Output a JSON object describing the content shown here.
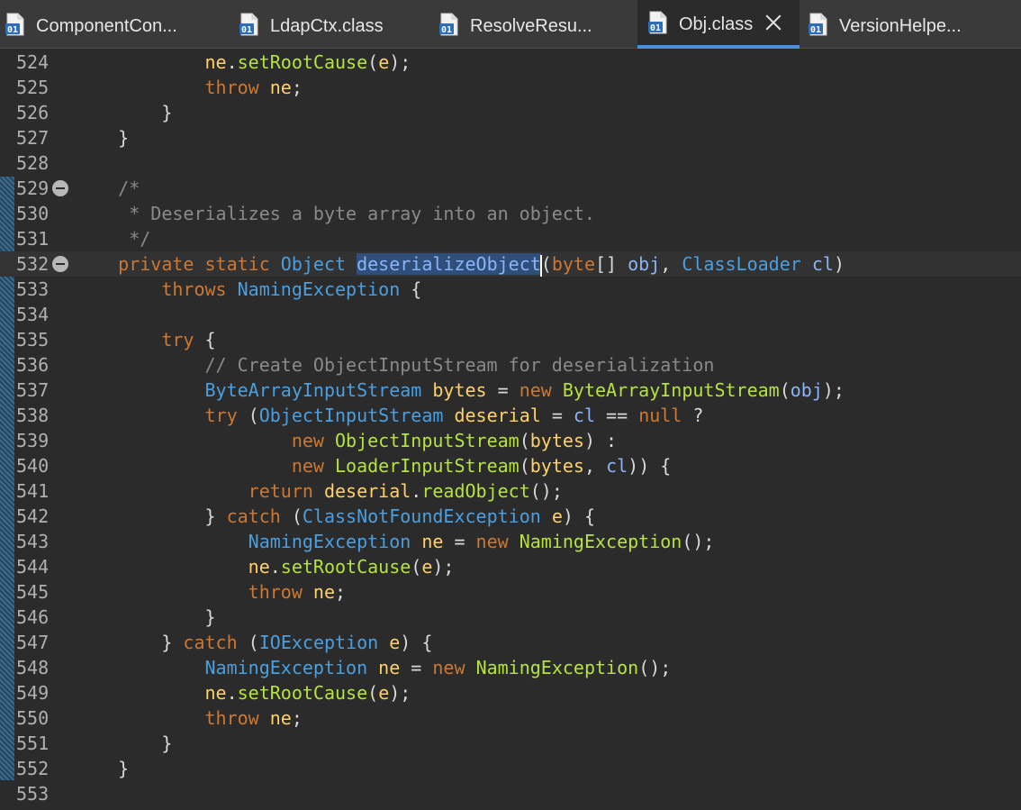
{
  "tabs": [
    {
      "label": "ComponentCon...",
      "icon": "class-file-icon",
      "active": false
    },
    {
      "label": "LdapCtx.class",
      "icon": "class-file-icon",
      "active": false
    },
    {
      "label": "ResolveResu...",
      "icon": "class-file-icon",
      "active": false
    },
    {
      "label": "Obj.class",
      "icon": "class-file-icon",
      "active": true
    },
    {
      "label": "VersionHelpe...",
      "icon": "class-file-icon",
      "active": false
    }
  ],
  "editor": {
    "current_line": 532,
    "selected_text": "deserializeObject",
    "lines": [
      {
        "n": "524",
        "tokens": [
          [
            "pl",
            "            "
          ],
          [
            "vr",
            "ne"
          ],
          [
            "pl",
            "."
          ],
          [
            "fn",
            "setRootCause"
          ],
          [
            "pl",
            "("
          ],
          [
            "vr",
            "e"
          ],
          [
            "pl",
            ");"
          ]
        ]
      },
      {
        "n": "525",
        "tokens": [
          [
            "pl",
            "            "
          ],
          [
            "kw",
            "throw"
          ],
          [
            "pl",
            " "
          ],
          [
            "vr",
            "ne"
          ],
          [
            "pl",
            ";"
          ]
        ]
      },
      {
        "n": "526",
        "tokens": [
          [
            "pl",
            "        }"
          ]
        ]
      },
      {
        "n": "527",
        "tokens": [
          [
            "pl",
            "    }"
          ]
        ]
      },
      {
        "n": "528",
        "tokens": []
      },
      {
        "n": "529",
        "fold": true,
        "tokens": [
          [
            "cm",
            "    /*"
          ]
        ]
      },
      {
        "n": "530",
        "tokens": [
          [
            "cm",
            "     * Deserializes a byte array into an object."
          ]
        ]
      },
      {
        "n": "531",
        "tokens": [
          [
            "cm",
            "     */"
          ]
        ]
      },
      {
        "n": "532",
        "fold": true,
        "tokens": [
          [
            "kw",
            "    private static "
          ],
          [
            "ty",
            "Object"
          ],
          [
            "pl",
            " "
          ],
          [
            "sel",
            "deserializeObject"
          ],
          [
            "caret",
            ""
          ],
          [
            "pl",
            "("
          ],
          [
            "kw",
            "byte"
          ],
          [
            "pl",
            "[] "
          ],
          [
            "pr",
            "obj"
          ],
          [
            "pl",
            ", "
          ],
          [
            "ty",
            "ClassLoader"
          ],
          [
            "pl",
            " "
          ],
          [
            "pr",
            "cl"
          ],
          [
            "pl",
            ")"
          ]
        ]
      },
      {
        "n": "533",
        "tokens": [
          [
            "pl",
            "        "
          ],
          [
            "kw",
            "throws"
          ],
          [
            "pl",
            " "
          ],
          [
            "ty",
            "NamingException"
          ],
          [
            "pl",
            " {"
          ]
        ]
      },
      {
        "n": "534",
        "tokens": []
      },
      {
        "n": "535",
        "tokens": [
          [
            "pl",
            "        "
          ],
          [
            "kw",
            "try"
          ],
          [
            "pl",
            " {"
          ]
        ]
      },
      {
        "n": "536",
        "tokens": [
          [
            "cm",
            "            // Create ObjectInputStream for deserialization"
          ]
        ]
      },
      {
        "n": "537",
        "tokens": [
          [
            "pl",
            "            "
          ],
          [
            "ty",
            "ByteArrayInputStream"
          ],
          [
            "pl",
            " "
          ],
          [
            "vr",
            "bytes"
          ],
          [
            "pl",
            " = "
          ],
          [
            "kw",
            "new"
          ],
          [
            "pl",
            " "
          ],
          [
            "fn",
            "ByteArrayInputStream"
          ],
          [
            "pl",
            "("
          ],
          [
            "pr",
            "obj"
          ],
          [
            "pl",
            ");"
          ]
        ]
      },
      {
        "n": "538",
        "tokens": [
          [
            "pl",
            "            "
          ],
          [
            "kw",
            "try"
          ],
          [
            "pl",
            " ("
          ],
          [
            "ty",
            "ObjectInputStream"
          ],
          [
            "pl",
            " "
          ],
          [
            "vr",
            "deserial"
          ],
          [
            "pl",
            " = "
          ],
          [
            "pr",
            "cl"
          ],
          [
            "pl",
            " == "
          ],
          [
            "kw",
            "null"
          ],
          [
            "pl",
            " ?"
          ]
        ]
      },
      {
        "n": "539",
        "tokens": [
          [
            "pl",
            "                    "
          ],
          [
            "kw",
            "new"
          ],
          [
            "pl",
            " "
          ],
          [
            "fn",
            "ObjectInputStream"
          ],
          [
            "pl",
            "("
          ],
          [
            "vr",
            "bytes"
          ],
          [
            "pl",
            ") :"
          ]
        ]
      },
      {
        "n": "540",
        "tokens": [
          [
            "pl",
            "                    "
          ],
          [
            "kw",
            "new"
          ],
          [
            "pl",
            " "
          ],
          [
            "fn",
            "LoaderInputStream"
          ],
          [
            "pl",
            "("
          ],
          [
            "vr",
            "bytes"
          ],
          [
            "pl",
            ", "
          ],
          [
            "pr",
            "cl"
          ],
          [
            "pl",
            ")) {"
          ]
        ]
      },
      {
        "n": "541",
        "tokens": [
          [
            "pl",
            "                "
          ],
          [
            "kw",
            "return"
          ],
          [
            "pl",
            " "
          ],
          [
            "vr",
            "deserial"
          ],
          [
            "pl",
            "."
          ],
          [
            "fn",
            "readObject"
          ],
          [
            "pl",
            "();"
          ]
        ]
      },
      {
        "n": "542",
        "tokens": [
          [
            "pl",
            "            } "
          ],
          [
            "kw",
            "catch"
          ],
          [
            "pl",
            " ("
          ],
          [
            "ty",
            "ClassNotFoundException"
          ],
          [
            "pl",
            " "
          ],
          [
            "vr",
            "e"
          ],
          [
            "pl",
            ") {"
          ]
        ]
      },
      {
        "n": "543",
        "tokens": [
          [
            "pl",
            "                "
          ],
          [
            "ty",
            "NamingException"
          ],
          [
            "pl",
            " "
          ],
          [
            "vr",
            "ne"
          ],
          [
            "pl",
            " = "
          ],
          [
            "kw",
            "new"
          ],
          [
            "pl",
            " "
          ],
          [
            "fn",
            "NamingException"
          ],
          [
            "pl",
            "();"
          ]
        ]
      },
      {
        "n": "544",
        "tokens": [
          [
            "pl",
            "                "
          ],
          [
            "vr",
            "ne"
          ],
          [
            "pl",
            "."
          ],
          [
            "fn",
            "setRootCause"
          ],
          [
            "pl",
            "("
          ],
          [
            "vr",
            "e"
          ],
          [
            "pl",
            ");"
          ]
        ]
      },
      {
        "n": "545",
        "tokens": [
          [
            "pl",
            "                "
          ],
          [
            "kw",
            "throw"
          ],
          [
            "pl",
            " "
          ],
          [
            "vr",
            "ne"
          ],
          [
            "pl",
            ";"
          ]
        ]
      },
      {
        "n": "546",
        "tokens": [
          [
            "pl",
            "            }"
          ]
        ]
      },
      {
        "n": "547",
        "tokens": [
          [
            "pl",
            "        } "
          ],
          [
            "kw",
            "catch"
          ],
          [
            "pl",
            " ("
          ],
          [
            "ty",
            "IOException"
          ],
          [
            "pl",
            " "
          ],
          [
            "vr",
            "e"
          ],
          [
            "pl",
            ") {"
          ]
        ]
      },
      {
        "n": "548",
        "tokens": [
          [
            "pl",
            "            "
          ],
          [
            "ty",
            "NamingException"
          ],
          [
            "pl",
            " "
          ],
          [
            "vr",
            "ne"
          ],
          [
            "pl",
            " = "
          ],
          [
            "kw",
            "new"
          ],
          [
            "pl",
            " "
          ],
          [
            "fn",
            "NamingException"
          ],
          [
            "pl",
            "();"
          ]
        ]
      },
      {
        "n": "549",
        "tokens": [
          [
            "pl",
            "            "
          ],
          [
            "vr",
            "ne"
          ],
          [
            "pl",
            "."
          ],
          [
            "fn",
            "setRootCause"
          ],
          [
            "pl",
            "("
          ],
          [
            "vr",
            "e"
          ],
          [
            "pl",
            ");"
          ]
        ]
      },
      {
        "n": "550",
        "tokens": [
          [
            "pl",
            "            "
          ],
          [
            "kw",
            "throw"
          ],
          [
            "pl",
            " "
          ],
          [
            "vr",
            "ne"
          ],
          [
            "pl",
            ";"
          ]
        ]
      },
      {
        "n": "551",
        "tokens": [
          [
            "pl",
            "        }"
          ]
        ]
      },
      {
        "n": "552",
        "tokens": [
          [
            "pl",
            "    }"
          ]
        ]
      },
      {
        "n": "553",
        "tokens": []
      }
    ]
  },
  "colors": {
    "background": "#2b2b2b",
    "keyword": "#cc7832",
    "type": "#4a9fe0",
    "method": "#b6e33e",
    "local_variable": "#ffd166",
    "parameter": "#8ab4f8",
    "comment": "#8a8a8a",
    "selection": "#2f4f7a",
    "active_tab_underline": "#4b8ed9"
  }
}
